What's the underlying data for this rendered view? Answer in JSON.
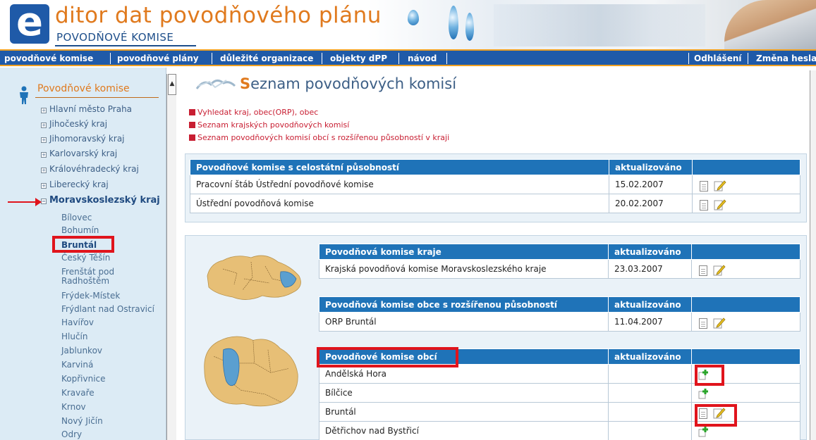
{
  "header": {
    "logo_letter": "e",
    "title": "ditor dat povodňového plánu",
    "subtitle": "POVODŇOVÉ KOMISE"
  },
  "nav": {
    "items": [
      "povodňové komise",
      "povodňové plány",
      "důležité organizace",
      "objekty dPP",
      "návod"
    ],
    "logout": "Odhlášení",
    "change_password": "Změna hesla"
  },
  "sidebar": {
    "title": "Povodňové komise",
    "regions": [
      "Hlavní město Praha",
      "Jihočeský kraj",
      "Jihomoravský kraj",
      "Karlovarský kraj",
      "Královéhradecký kraj",
      "Liberecký kraj",
      "Moravskoslezský kraj"
    ],
    "cities": [
      "Bílovec",
      "Bohumín",
      "Bruntál",
      "Český Těšín",
      "Frenštát pod",
      "Radhoštěm",
      "Frýdek-Místek",
      "Frýdlant nad Ostravicí",
      "Havířov",
      "Hlučín",
      "Jablunkov",
      "Karviná",
      "Kopřivnice",
      "Kravaře",
      "Krnov",
      "Nový Jičín",
      "Odry"
    ]
  },
  "main": {
    "title_first": "S",
    "title_rest": "eznam povodňových komisí",
    "links": [
      "Vyhledat kraj, obec(ORP), obec",
      "Seznam krajských povodňových komisí",
      "Seznam povodňových komisí obcí s rozšířenou působností v kraji"
    ],
    "updated_label": "aktualizováno",
    "national": {
      "header": "Povodňové komise s celostátní působností",
      "rows": [
        {
          "name": "Pracovní štáb Ústřední povodňové komise",
          "date": "15.02.2007"
        },
        {
          "name": "Ústřední povodňová komise",
          "date": "20.02.2007"
        }
      ]
    },
    "region": {
      "header": "Povodňová komise kraje",
      "rows": [
        {
          "name": "Krajská povodňová komise Moravskoslezského kraje",
          "date": "23.03.2007"
        }
      ]
    },
    "orp": {
      "header": "Povodňová komise obce s rozšířenou působností",
      "rows": [
        {
          "name": "ORP Bruntál",
          "date": "11.04.2007"
        }
      ]
    },
    "municipal": {
      "header": "Povodňové komise obcí",
      "rows": [
        {
          "name": "Andělská Hora",
          "date": ""
        },
        {
          "name": "Bílčice",
          "date": ""
        },
        {
          "name": "Bruntál",
          "date": ""
        },
        {
          "name": "Dětřichov nad Bystřicí",
          "date": ""
        }
      ]
    }
  },
  "colors": {
    "brand_blue": "#1f5aa8",
    "table_header": "#1f73b8",
    "accent_orange": "#e07a1e",
    "highlight_red": "#e0141c"
  },
  "icons": [
    "document-icon",
    "edit-pencil-icon",
    "add-document-icon",
    "person-icon",
    "scroll-up-icon"
  ]
}
